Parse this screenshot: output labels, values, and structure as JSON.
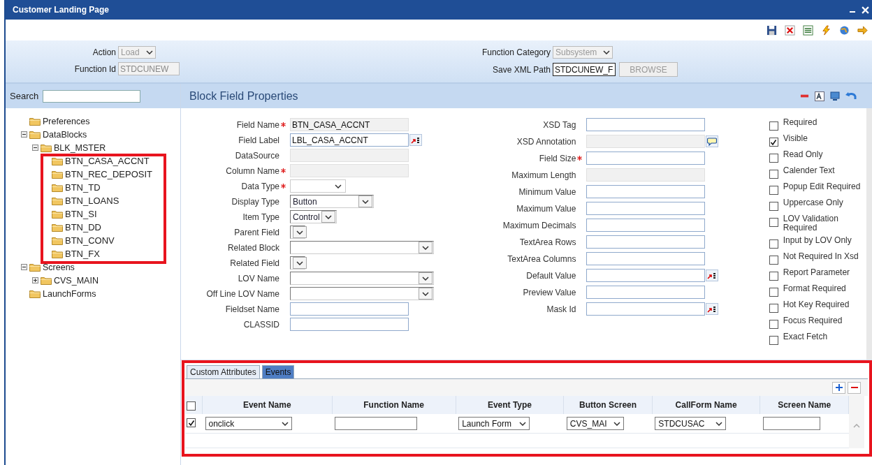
{
  "window": {
    "title": "Customer Landing Page"
  },
  "header": {
    "action": {
      "label": "Action",
      "value": "Load"
    },
    "function_id": {
      "label": "Function Id",
      "value": "STDCUNEW"
    },
    "function_category": {
      "label": "Function Category",
      "value": "Subsystem"
    },
    "save_xml_path": {
      "label": "Save XML Path",
      "value": "STDCUNEW_F"
    },
    "browse_button": "BROWSE"
  },
  "sidebar": {
    "search": {
      "label": "Search"
    },
    "tree": [
      {
        "label": "Preferences"
      },
      {
        "label": "DataBlocks",
        "expanded": true,
        "children": [
          {
            "label": "BLK_MSTER",
            "expanded": true,
            "children": [
              {
                "label": "BTN_CASA_ACCNT"
              },
              {
                "label": "BTN_REC_DEPOSIT"
              },
              {
                "label": "BTN_TD"
              },
              {
                "label": "BTN_LOANS"
              },
              {
                "label": "BTN_SI"
              },
              {
                "label": "BTN_DD"
              },
              {
                "label": "BTN_CONV"
              },
              {
                "label": "BTN_FX"
              }
            ]
          }
        ]
      },
      {
        "label": "Screens",
        "expanded": true,
        "children": [
          {
            "label": "CVS_MAIN",
            "expanded": false
          }
        ]
      },
      {
        "label": "LaunchForms"
      }
    ]
  },
  "panel": {
    "title": "Block Field Properties"
  },
  "fields_left": [
    {
      "label": "Field Name",
      "required": true,
      "kind": "readonly",
      "value": "BTN_CASA_ACCNT"
    },
    {
      "label": "Field Label",
      "required": false,
      "kind": "text",
      "value": "LBL_CASA_ACCNT",
      "lookup": true
    },
    {
      "label": "DataSource",
      "required": false,
      "kind": "readonly"
    },
    {
      "label": "Column Name",
      "required": true,
      "kind": "readonly"
    },
    {
      "label": "Data Type",
      "required": true,
      "kind": "combo"
    },
    {
      "label": "Display Type",
      "required": false,
      "kind": "select",
      "value": "Button"
    },
    {
      "label": "Item Type",
      "required": false,
      "kind": "select",
      "value": "Control"
    },
    {
      "label": "Parent Field",
      "required": false,
      "kind": "select"
    },
    {
      "label": "Related Block",
      "required": false,
      "kind": "select"
    },
    {
      "label": "Related Field",
      "required": false,
      "kind": "select"
    },
    {
      "label": "LOV Name",
      "required": false,
      "kind": "select"
    },
    {
      "label": "Off Line LOV Name",
      "required": false,
      "kind": "select"
    },
    {
      "label": "Fieldset Name",
      "required": false,
      "kind": "text"
    },
    {
      "label": "CLASSID",
      "required": false,
      "kind": "text"
    }
  ],
  "fields_middle": [
    {
      "label": "XSD Tag",
      "required": false,
      "kind": "text"
    },
    {
      "label": "XSD Annotation",
      "required": false,
      "kind": "readonly",
      "note": true
    },
    {
      "label": "Field Size",
      "required": true,
      "kind": "text"
    },
    {
      "label": "Maximum Length",
      "required": false,
      "kind": "readonly"
    },
    {
      "label": "Minimum Value",
      "required": false,
      "kind": "text"
    },
    {
      "label": "Maximum Value",
      "required": false,
      "kind": "text"
    },
    {
      "label": "Maximum Decimals",
      "required": false,
      "kind": "text"
    },
    {
      "label": "TextArea Rows",
      "required": false,
      "kind": "text"
    },
    {
      "label": "TextArea Columns",
      "required": false,
      "kind": "text"
    },
    {
      "label": "Default Value",
      "required": false,
      "kind": "text",
      "lookup": true
    },
    {
      "label": "Preview Value",
      "required": false,
      "kind": "text"
    },
    {
      "label": "Mask Id",
      "required": false,
      "kind": "text",
      "lookup": true
    }
  ],
  "options": [
    {
      "label": "Required",
      "checked": false
    },
    {
      "label": "Visible",
      "checked": true
    },
    {
      "label": "Read Only",
      "checked": false
    },
    {
      "label": "Calender Text",
      "checked": false
    },
    {
      "label": "Popup Edit Required",
      "checked": false
    },
    {
      "label": "Uppercase Only",
      "checked": false
    },
    {
      "label": "LOV Validation Required",
      "checked": false
    },
    {
      "label": "Input by LOV Only",
      "checked": false
    },
    {
      "label": "Not Required In Xsd",
      "checked": false
    },
    {
      "label": "Report Parameter",
      "checked": false
    },
    {
      "label": "Format Required",
      "checked": false
    },
    {
      "label": "Hot Key Required",
      "checked": false
    },
    {
      "label": "Focus Required",
      "checked": false
    },
    {
      "label": "Exact Fetch",
      "checked": false
    }
  ],
  "tabs": [
    {
      "label": "Custom Attributes",
      "selected": false
    },
    {
      "label": "Events",
      "selected": true
    }
  ],
  "events_table": {
    "header_checked": false,
    "columns": [
      "Event Name",
      "Function Name",
      "Event Type",
      "Button Screen",
      "CallForm Name",
      "Screen Name"
    ],
    "rows": [
      {
        "checked": true,
        "cells": [
          {
            "kind": "select",
            "value": "onclick"
          },
          {
            "kind": "text"
          },
          {
            "kind": "select",
            "value": "Launch Form"
          },
          {
            "kind": "select",
            "value": "CVS_MAI"
          },
          {
            "kind": "select",
            "value": "STDCUSAC"
          },
          {
            "kind": "text"
          }
        ]
      }
    ]
  }
}
